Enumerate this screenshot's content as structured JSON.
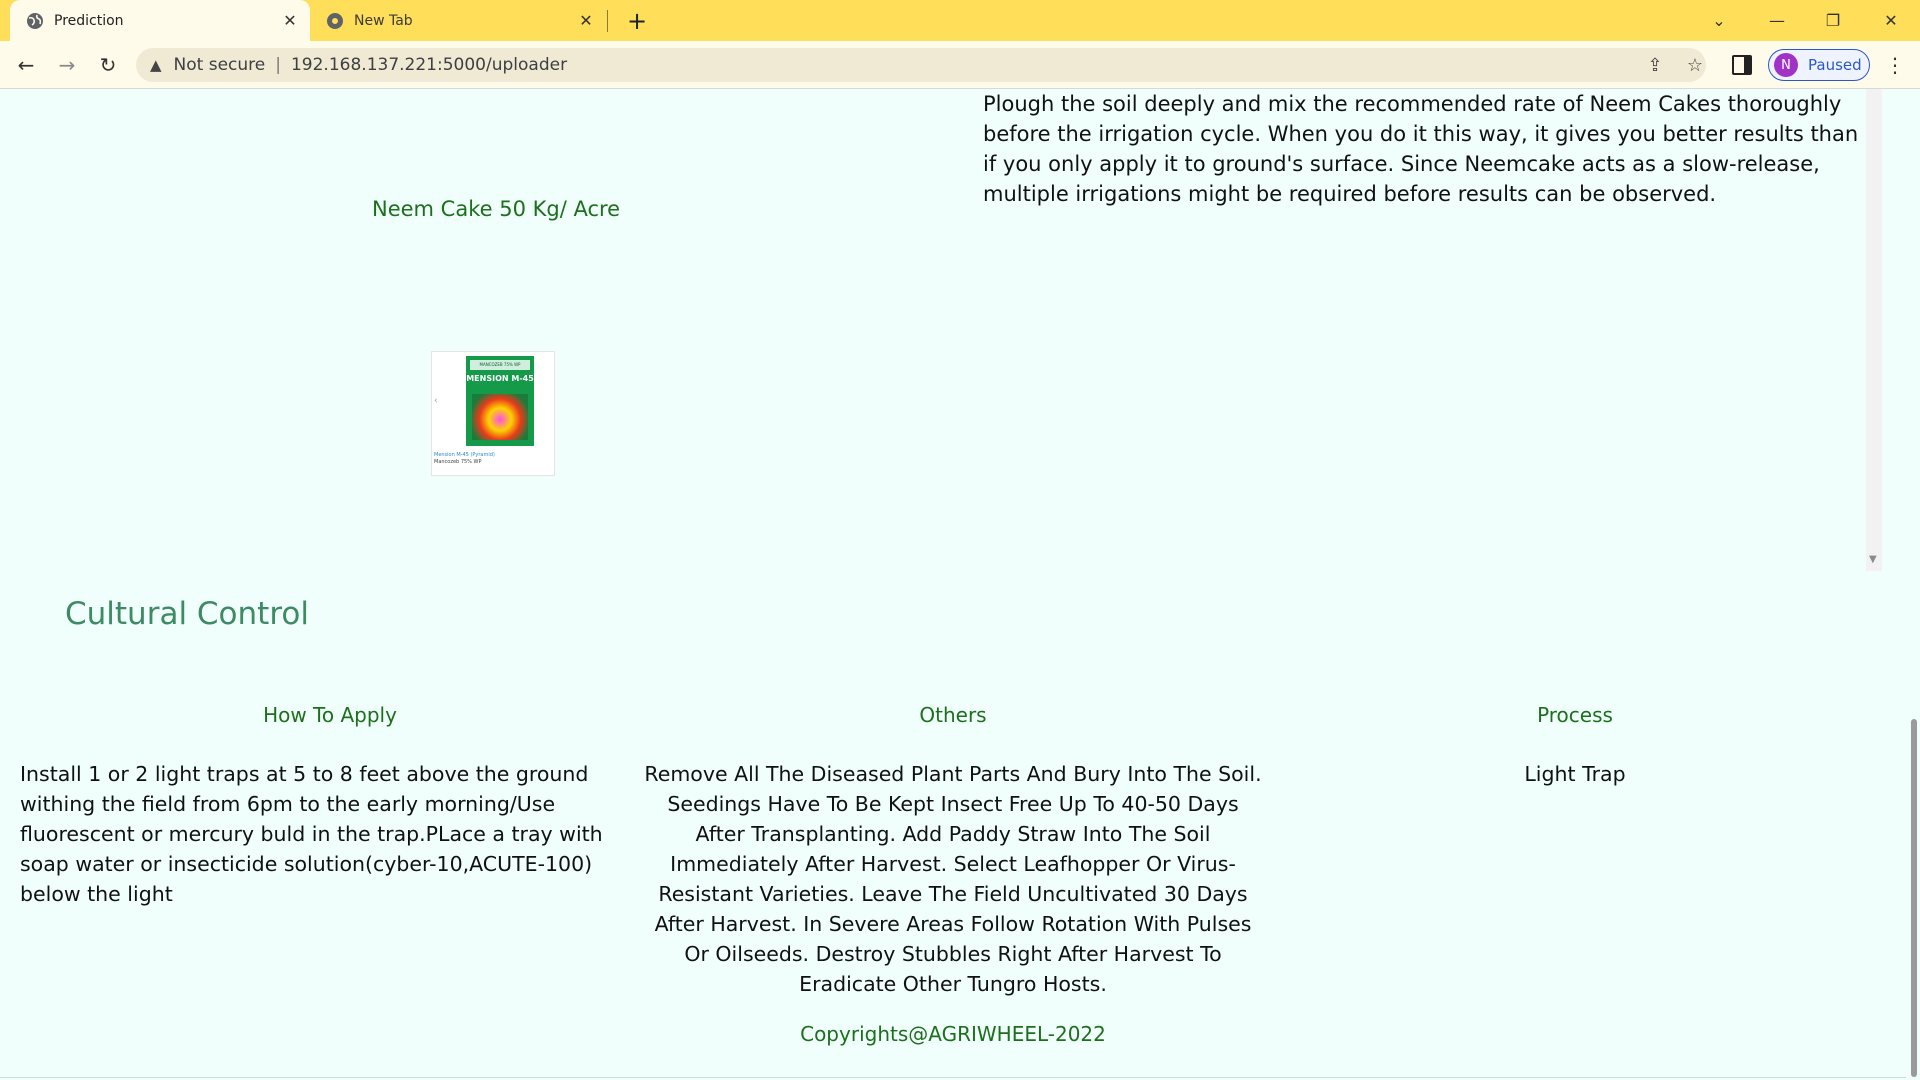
{
  "browser": {
    "tabs": [
      {
        "title": "Prediction",
        "active": true
      },
      {
        "title": "New Tab",
        "active": false
      }
    ],
    "close_glyph": "✕",
    "new_tab_glyph": "+",
    "address": {
      "security_label": "Not secure",
      "divider": "|",
      "url": "192.168.137.221:5000/uploader"
    },
    "profile": {
      "initial": "N",
      "status": "Paused"
    },
    "icons": {
      "back": "←",
      "forward": "→",
      "reload": "↻",
      "warning": "▲",
      "share": "⇪",
      "star": "☆",
      "menu": "⋮",
      "tab_search": "⌄",
      "minimize": "—",
      "restore": "❐",
      "close": "✕"
    }
  },
  "page": {
    "chemical": {
      "name": "Neem Cake 50 Kg/ Acre",
      "instructions": "Plough the soil deeply and mix the recommended rate of Neem Cakes thoroughly before the irrigation cycle. When you do it this way, it gives you better results than if you only apply it to ground's surface. Since Neemcake acts as a slow-release, multiple irrigations might be required before results can be observed.",
      "product_image": {
        "band_text": "MANCOZEB 75% WP",
        "brand": "MENSION M-45",
        "caption_line1": "Mension M-45 (Pyramid)",
        "caption_line2": "Mancozeb 75% WP"
      }
    },
    "cultural_control": {
      "title": "Cultural Control",
      "how_to_apply": {
        "heading": "How To Apply",
        "text": "Install 1 or 2 light traps at 5 to 8 feet above the ground withing the field from 6pm to the early morning/Use fluorescent or mercury buld in the trap.PLace a tray with soap water or insecticide solution(cyber-10,ACUTE-100) below the light"
      },
      "others": {
        "heading": "Others",
        "text": "Remove All The Diseased Plant Parts And Bury Into The Soil. Seedings Have To Be Kept Insect Free Up To 40-50 Days After Transplanting. Add Paddy Straw Into The Soil Immediately After Harvest. Select Leafhopper Or Virus-Resistant Varieties. Leave The Field Uncultivated 30 Days After Harvest. In Severe Areas Follow Rotation With Pulses Or Oilseeds. Destroy Stubbles Right After Harvest To Eradicate Other Tungro Hosts."
      },
      "process": {
        "heading": "Process",
        "text": "Light Trap"
      }
    },
    "footer": "Copyrights@AGRIWHEEL-2022"
  },
  "colors": {
    "tabstrip": "#ffde59",
    "page_bg": "#f0fffb",
    "heading_green": "#1d6f1d",
    "section_title": "#3e8a65",
    "profile_accent": "#2a58c9",
    "avatar": "#a033c6"
  }
}
